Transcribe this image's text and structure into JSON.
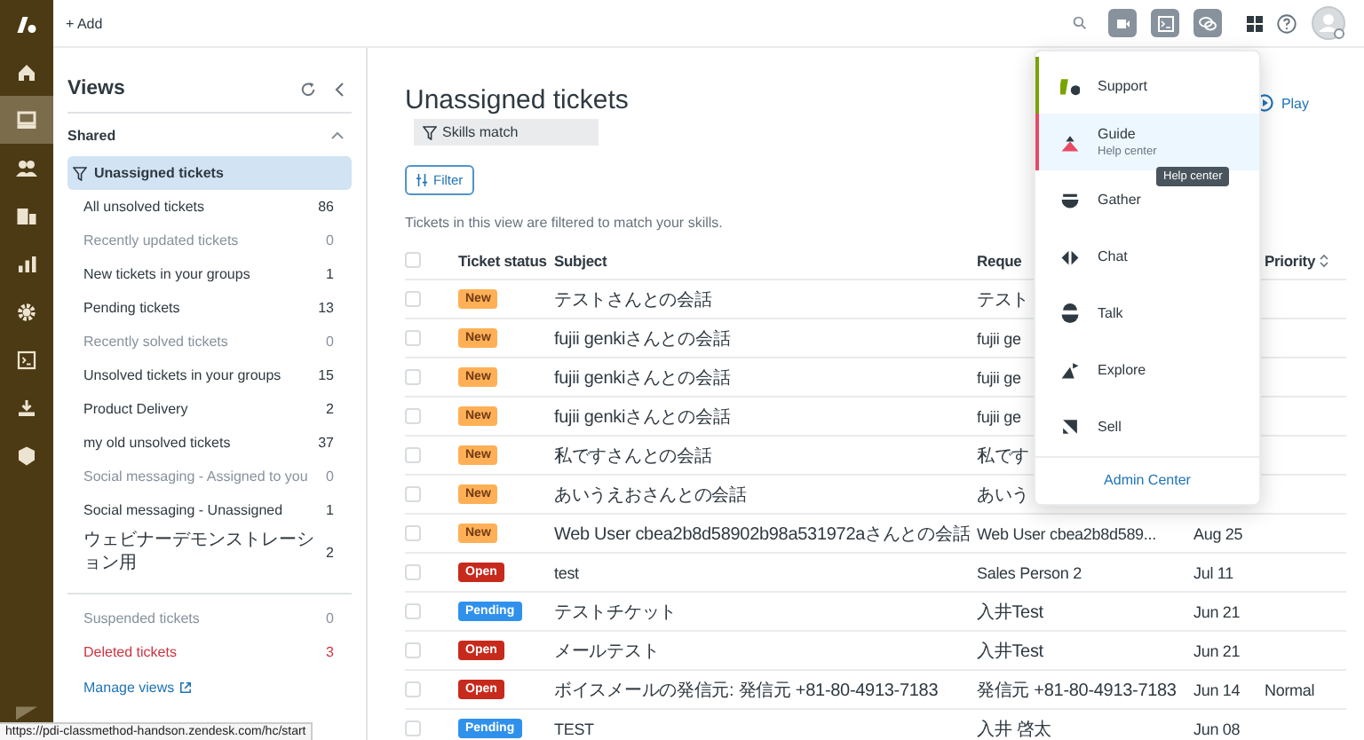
{
  "topbar": {
    "add_button": "+ Add"
  },
  "rail": {
    "items": [
      {
        "selected": false
      },
      {
        "selected": true
      },
      {
        "selected": false
      },
      {
        "selected": false
      },
      {
        "selected": false
      },
      {
        "selected": false
      },
      {
        "selected": false
      },
      {
        "selected": false
      },
      {
        "selected": false
      }
    ]
  },
  "views": {
    "title": "Views",
    "section": {
      "label": "Shared",
      "expanded": true
    },
    "items": [
      {
        "label": "Unassigned tickets",
        "selected": true,
        "kind": "normal"
      },
      {
        "label": "All unsolved tickets",
        "count": "86",
        "selected": false,
        "kind": "normal"
      },
      {
        "label": "Recently updated tickets",
        "count": "0",
        "selected": false,
        "kind": "muted"
      },
      {
        "label": "New tickets in your groups",
        "count": "1",
        "selected": false,
        "kind": "normal"
      },
      {
        "label": "Pending tickets",
        "count": "13",
        "selected": false,
        "kind": "normal"
      },
      {
        "label": "Recently solved tickets",
        "count": "0",
        "selected": false,
        "kind": "muted"
      },
      {
        "label": "Unsolved tickets in your groups",
        "count": "15",
        "selected": false,
        "kind": "normal"
      },
      {
        "label": "Product Delivery",
        "count": "2",
        "selected": false,
        "kind": "normal"
      },
      {
        "label": "my old unsolved tickets",
        "count": "37",
        "selected": false,
        "kind": "normal"
      },
      {
        "label": "Social messaging - Assigned to you",
        "count": "0",
        "selected": false,
        "kind": "muted"
      },
      {
        "label": "Social messaging - Unassigned",
        "count": "1",
        "selected": false,
        "kind": "normal"
      },
      {
        "label": "ウェビナーデモンストレーション用",
        "count": "2",
        "selected": false,
        "kind": "normal"
      }
    ],
    "footer_items": [
      {
        "label": "Suspended tickets",
        "count": "0",
        "kind": "muted"
      },
      {
        "label": "Deleted tickets",
        "count": "3",
        "kind": "danger"
      }
    ],
    "manage_link": "Manage views"
  },
  "main": {
    "title": "Unassigned tickets",
    "skills_chip": "Skills match",
    "play_link": "Play",
    "filter_button": "Filter",
    "note": "Tickets in this view are filtered to match your skills.",
    "table": {
      "select_all": {
        "checked": false
      },
      "columns": {
        "status": "Ticket status",
        "subject": "Subject",
        "requester": "Reque",
        "priority": "Priority"
      },
      "rows": [
        {
          "checked": false,
          "status": {
            "label": "New",
            "kind": "new"
          },
          "subject": "テストさんとの会話",
          "requester": "テスト"
        },
        {
          "checked": false,
          "status": {
            "label": "New",
            "kind": "new"
          },
          "subject": "fujii genkiさんとの会話",
          "requester": "fujii ge"
        },
        {
          "checked": false,
          "status": {
            "label": "New",
            "kind": "new"
          },
          "subject": "fujii genkiさんとの会話",
          "requester": "fujii ge"
        },
        {
          "checked": false,
          "status": {
            "label": "New",
            "kind": "new"
          },
          "subject": "fujii genkiさんとの会話",
          "requester": "fujii ge"
        },
        {
          "checked": false,
          "status": {
            "label": "New",
            "kind": "new"
          },
          "subject": "私ですさんとの会話",
          "requester": "私です"
        },
        {
          "checked": false,
          "status": {
            "label": "New",
            "kind": "new"
          },
          "subject": "あいうえおさんとの会話",
          "requester": "あいう"
        },
        {
          "checked": false,
          "status": {
            "label": "New",
            "kind": "new"
          },
          "subject": "Web User cbea2b8d58902b98a531972aさんとの会話",
          "requester": "Web User cbea2b8d589...",
          "column_5": "Aug 25"
        },
        {
          "checked": false,
          "status": {
            "label": "Open",
            "kind": "open"
          },
          "subject": "test",
          "requester": "Sales Person 2",
          "column_5": "Jul 11"
        },
        {
          "checked": false,
          "status": {
            "label": "Pending",
            "kind": "pending"
          },
          "subject": "テストチケット",
          "requester": "入井Test",
          "column_5": "Jun 21"
        },
        {
          "checked": false,
          "status": {
            "label": "Open",
            "kind": "open"
          },
          "subject": "メールテスト",
          "requester": "入井Test",
          "column_5": "Jun 21"
        },
        {
          "checked": false,
          "status": {
            "label": "Open",
            "kind": "open"
          },
          "subject": "ボイスメールの発信元: 発信元 +81-80-4913-7183",
          "requester": "発信元 +81-80-4913-7183",
          "column_5": "Jun 14",
          "priority": "Normal"
        },
        {
          "checked": false,
          "status": {
            "label": "Pending",
            "kind": "pending"
          },
          "subject": "TEST",
          "requester": "入井 啓太",
          "column_5": "Jun 08"
        }
      ]
    }
  },
  "product_menu": {
    "products": [
      {
        "label": "Support",
        "color": "#78a300",
        "current": true,
        "selected": false
      },
      {
        "label": "Guide",
        "subtitle": "Help center",
        "color": "#eb4962",
        "current": false,
        "selected": true
      },
      {
        "label": "Gather",
        "color": "#2f3941",
        "current": false,
        "selected": false
      },
      {
        "label": "Chat",
        "color": "#2f3941",
        "current": false,
        "selected": false
      },
      {
        "label": "Talk",
        "color": "#2f3941",
        "current": false,
        "selected": false
      },
      {
        "label": "Explore",
        "color": "#2f3941",
        "current": false,
        "selected": false
      },
      {
        "label": "Sell",
        "color": "#2f3941",
        "current": false,
        "selected": false
      }
    ],
    "admin_link": "Admin Center"
  },
  "tooltip": "Help center",
  "status_url": "https://pdi-classmethod-handson.zendesk.com/hc/start"
}
